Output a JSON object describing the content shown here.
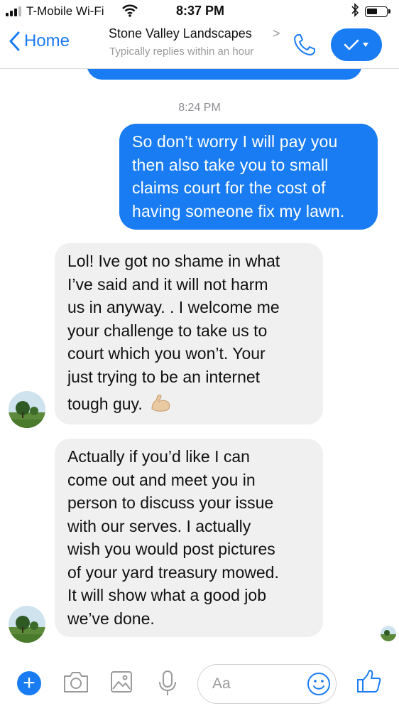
{
  "status_bar": {
    "carrier": "T-Mobile Wi-Fi",
    "time": "8:37 PM"
  },
  "header": {
    "back_label": "Home",
    "title": "Stone Valley Landscapes",
    "title_chevron": ">",
    "subtitle": "Typically replies within an hour"
  },
  "conversation": {
    "timestamp": "8:24 PM",
    "messages": [
      {
        "direction": "outgoing",
        "lines": [
          "So don’t worry I will pay you",
          "then also take you to small",
          "claims court for the cost of",
          "having someone fix my lawn."
        ]
      },
      {
        "direction": "incoming",
        "lines": [
          "Lol!  Ive got no shame in what",
          "I’ve said and it will not harm",
          "us in anyway.  .  I welcome me",
          "your challenge to take us to",
          "court which you won’t.  Your",
          "just trying to be an internet",
          "tough guy."
        ],
        "emoji": "flexed-biceps"
      },
      {
        "direction": "incoming",
        "lines": [
          "Actually if you’d like I can",
          "come out and meet you in",
          "person to discuss your issue",
          "with our serves.  I actually",
          "wish you would post pictures",
          "of your yard treasury mowed.",
          "It will show what a good job",
          "we’ve done."
        ]
      }
    ]
  },
  "composer": {
    "placeholder": "Aa"
  },
  "colors": {
    "accent": "#1a7cf2",
    "incoming_bubble": "#f0f0f0",
    "muted_text": "#9a9a9a"
  }
}
